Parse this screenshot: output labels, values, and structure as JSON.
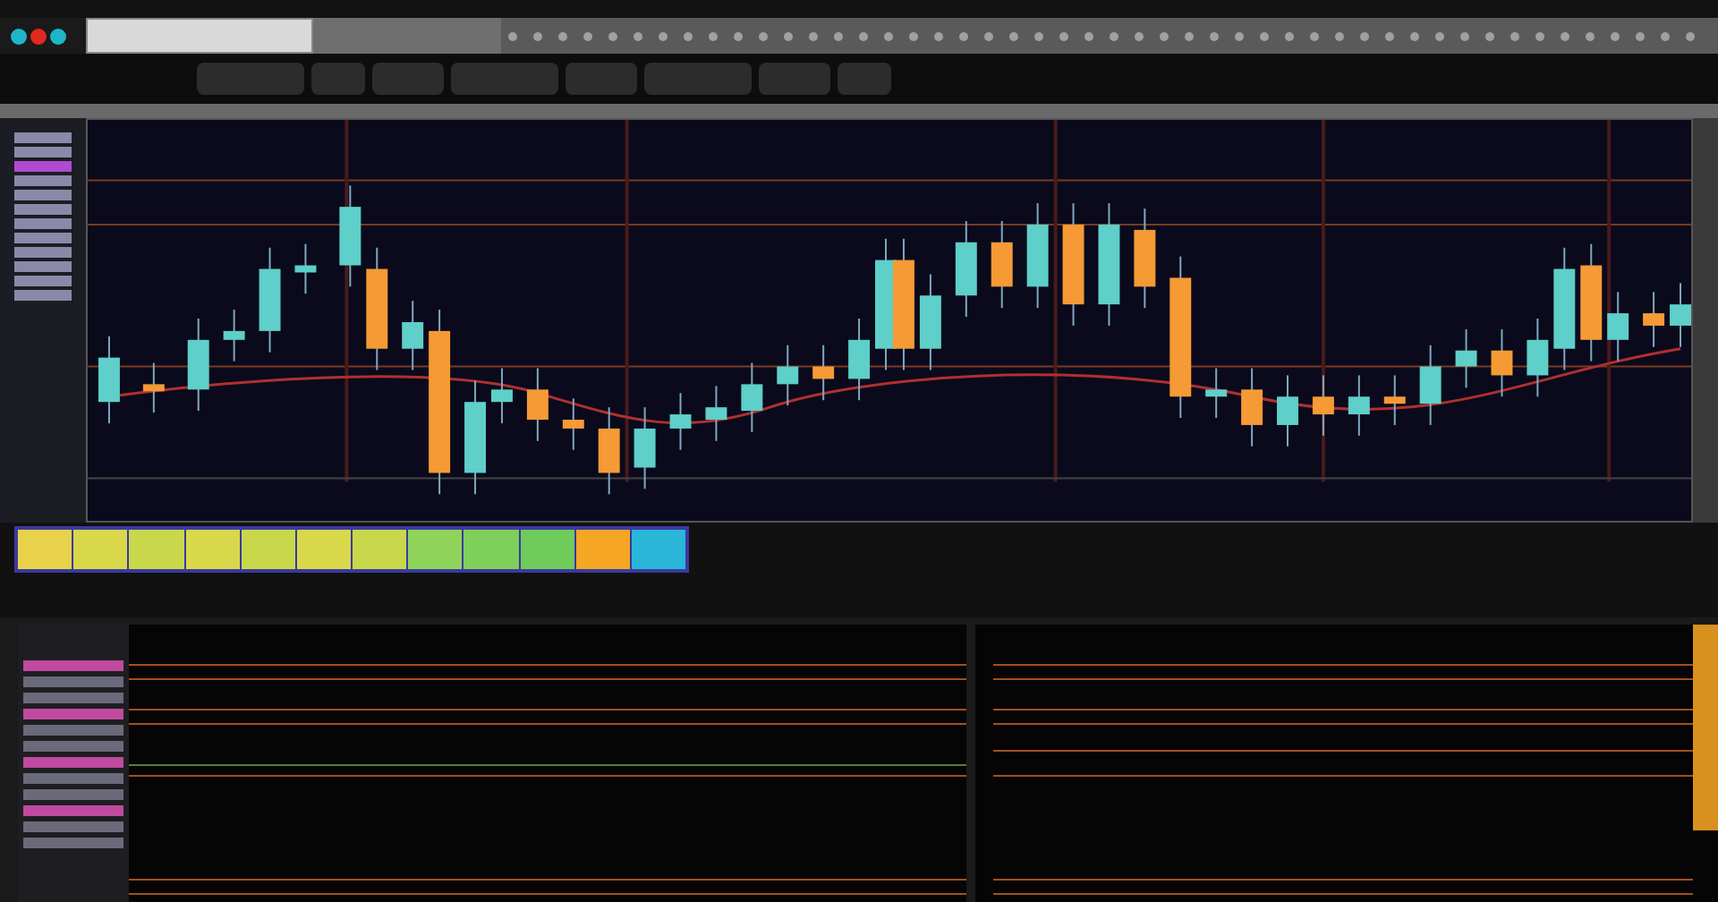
{
  "sidebar_items": [
    {
      "selected": false
    },
    {
      "selected": false
    },
    {
      "selected": true
    },
    {
      "selected": false
    },
    {
      "selected": false
    },
    {
      "selected": false
    },
    {
      "selected": false
    },
    {
      "selected": false
    },
    {
      "selected": false
    },
    {
      "selected": false
    },
    {
      "selected": false
    },
    {
      "selected": false
    }
  ],
  "window_buttons": [
    {
      "color": "#1fb5c9"
    },
    {
      "color": "#e0281e"
    },
    {
      "color": "#1fb5c9"
    }
  ],
  "timeline_segments": [
    {
      "color": "#e8d24a"
    },
    {
      "color": "#d8d84a"
    },
    {
      "color": "#c8d84a"
    },
    {
      "color": "#d8d84a"
    },
    {
      "color": "#c8d84a"
    },
    {
      "color": "#d8d84a"
    },
    {
      "color": "#c8d84a"
    },
    {
      "color": "#8fd45a"
    },
    {
      "color": "#7fd05a"
    },
    {
      "color": "#6fcc5a"
    },
    {
      "color": "#f5a623"
    },
    {
      "color": "#29b6d8"
    }
  ]
}
